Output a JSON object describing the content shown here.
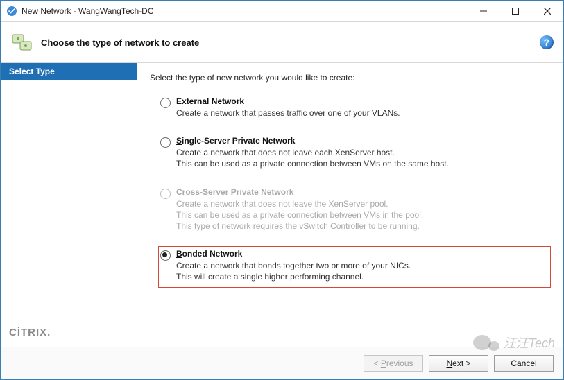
{
  "window": {
    "title": "New Network - WangWangTech-DC"
  },
  "header": {
    "heading": "Choose the type of network to create"
  },
  "sidebar": {
    "steps": [
      {
        "label": "Select Type",
        "active": true
      }
    ],
    "brand": "CİTRIX"
  },
  "content": {
    "prompt": "Select the type of new network you would like to create:",
    "options": [
      {
        "id": "external",
        "label_pre": "E",
        "label_rest": "xternal Network",
        "desc": "Create a network that passes traffic over one of your VLANs.",
        "selected": false,
        "disabled": false,
        "highlight": false
      },
      {
        "id": "single",
        "label_pre": "S",
        "label_rest": "ingle-Server Private Network",
        "desc": "Create a network that does not leave each XenServer host.\nThis can be used as a private connection between VMs on the same host.",
        "selected": false,
        "disabled": false,
        "highlight": false
      },
      {
        "id": "cross",
        "label_pre": "C",
        "label_rest": "ross-Server Private Network",
        "desc": "Create a network that does not leave the XenServer pool.\nThis can be used as a private connection between VMs in the pool.\nThis type of network requires the vSwitch Controller to be running.",
        "selected": false,
        "disabled": true,
        "highlight": false
      },
      {
        "id": "bonded",
        "label_pre": "B",
        "label_rest": "onded Network",
        "desc": "Create a network that bonds together two or more of your NICs.\nThis will create a single higher performing channel.",
        "selected": true,
        "disabled": false,
        "highlight": true
      }
    ]
  },
  "footer": {
    "previous_pre": "< ",
    "previous_ul": "P",
    "previous_rest": "revious",
    "next_ul": "N",
    "next_rest": "ext >",
    "cancel": "Cancel"
  },
  "watermark": {
    "text": "汪汪Tech"
  }
}
